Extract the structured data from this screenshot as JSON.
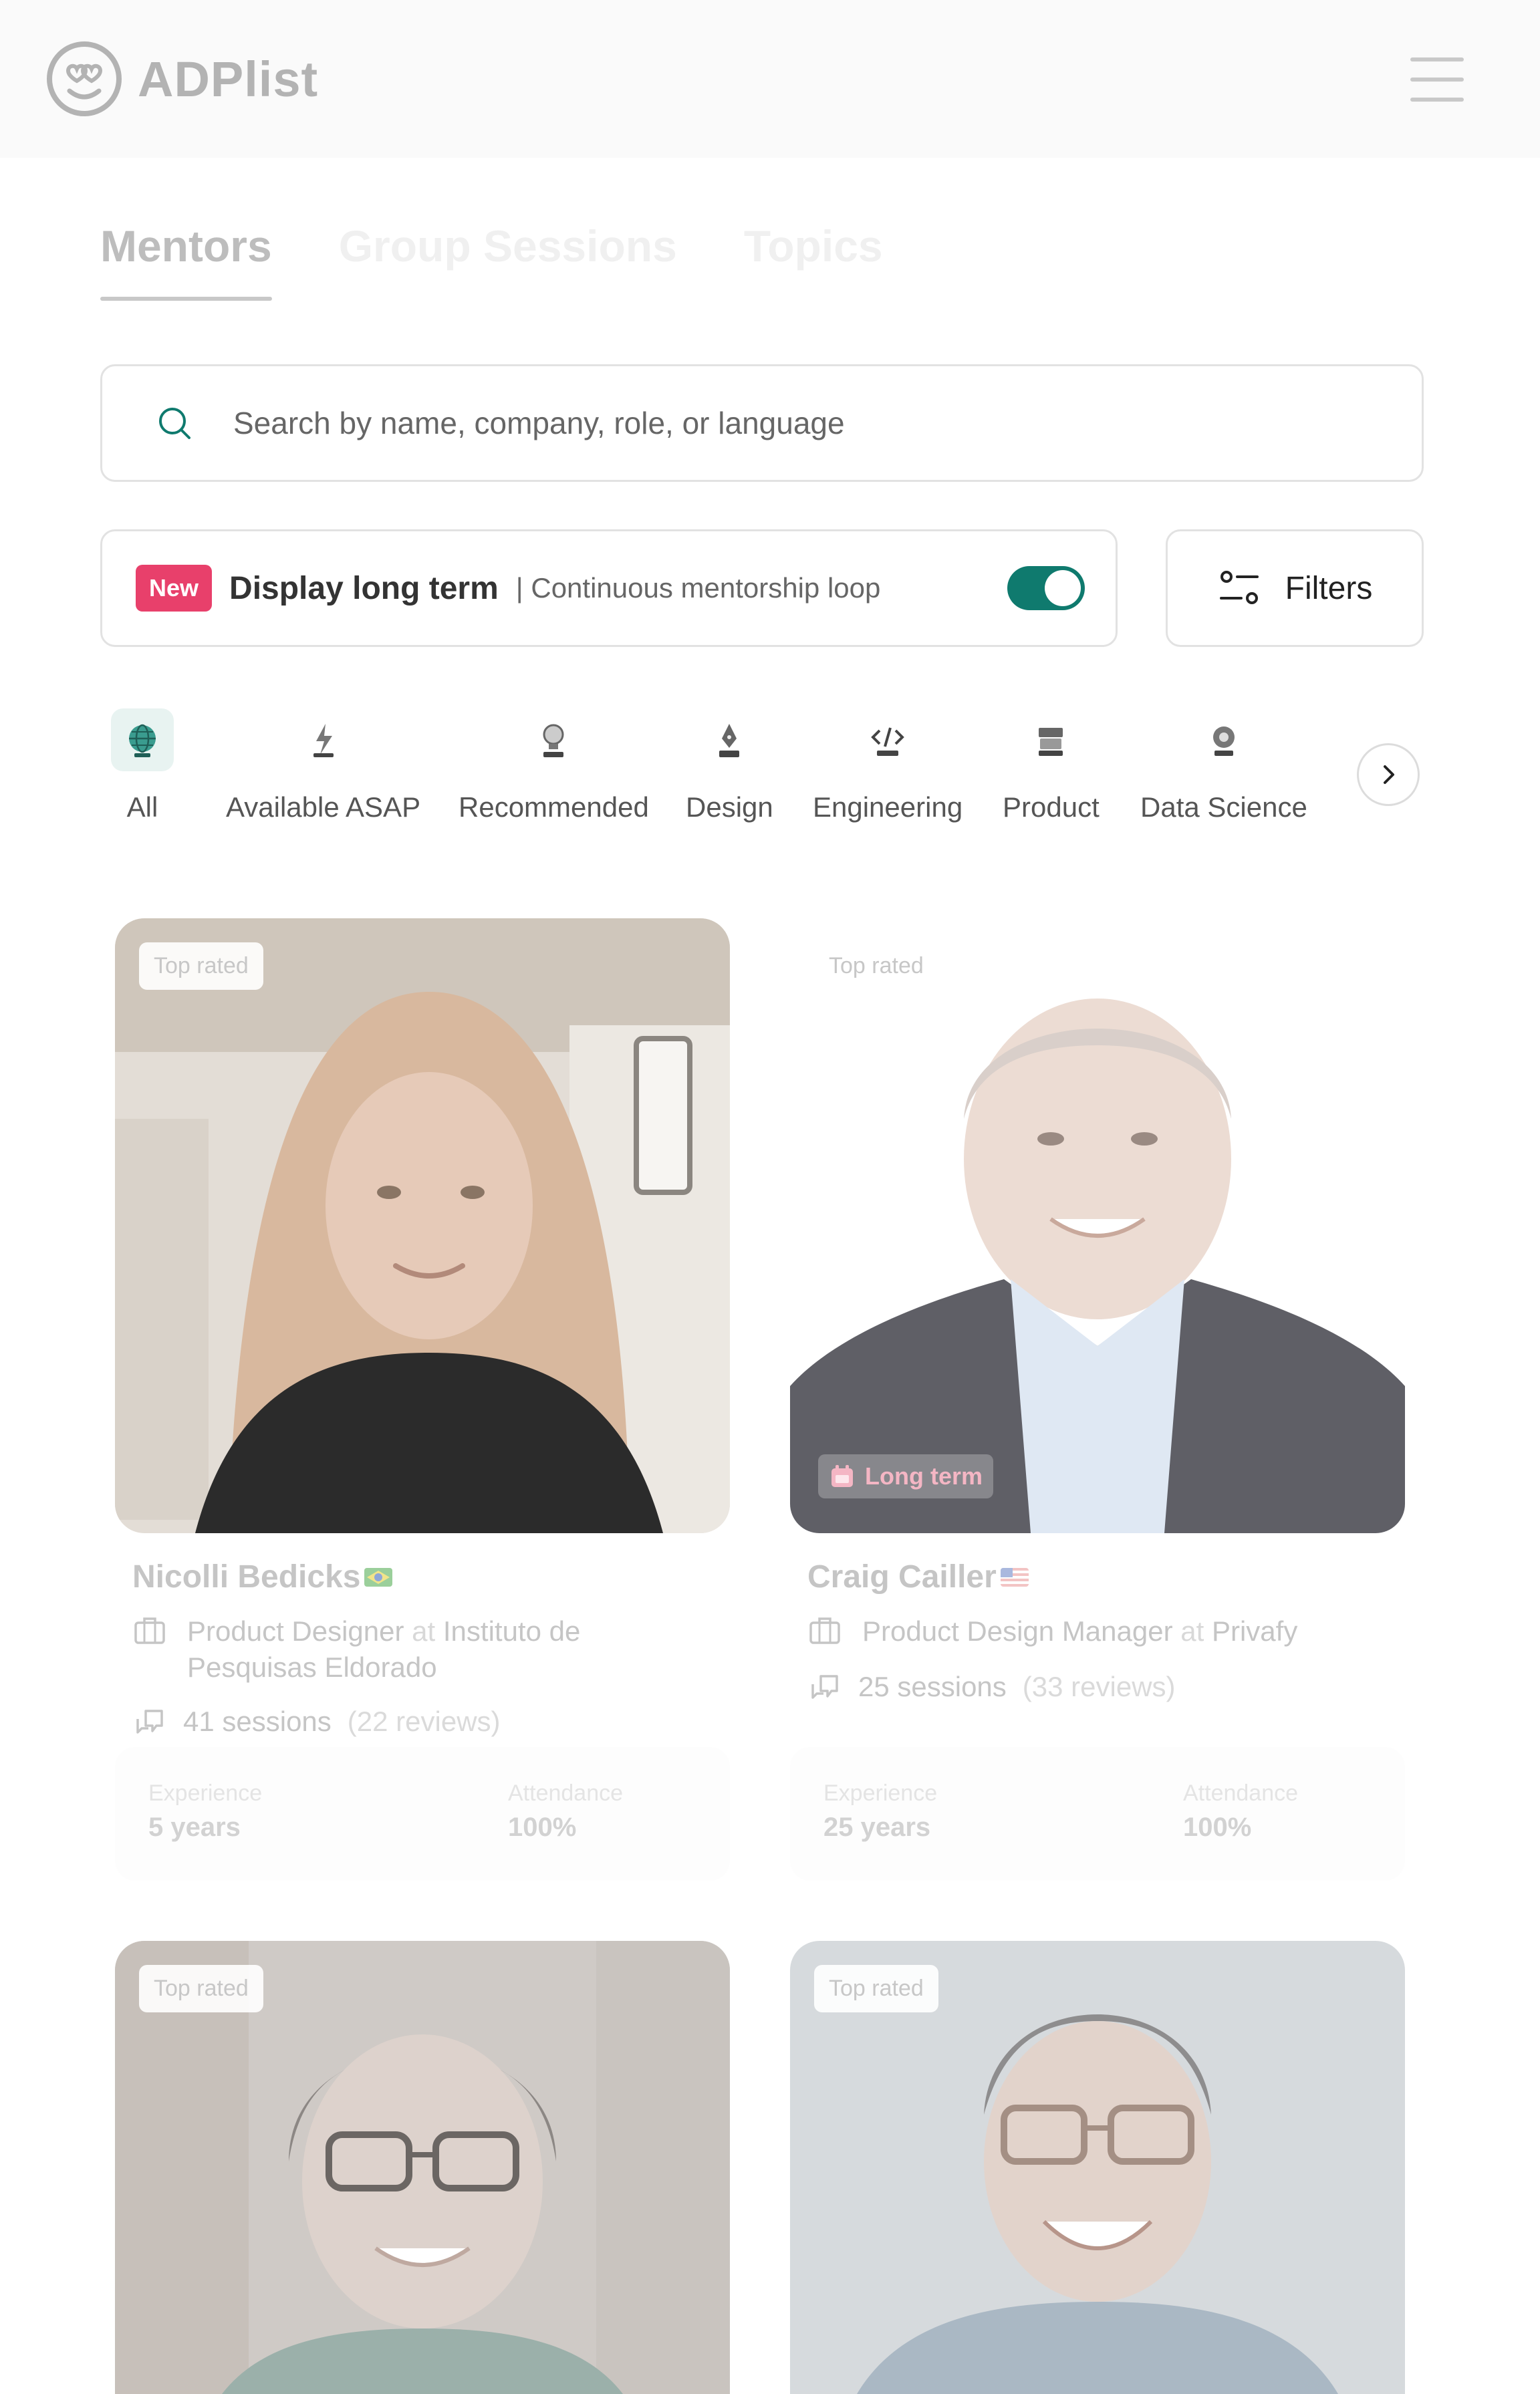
{
  "app": {
    "name": "ADPlist"
  },
  "tabs": [
    {
      "label": "Mentors",
      "active": true
    },
    {
      "label": "Group Sessions",
      "active": false
    },
    {
      "label": "Topics",
      "active": false
    }
  ],
  "search": {
    "placeholder": "Search by name, company, role, or language"
  },
  "long_term": {
    "badge": "New",
    "title": "Display long term",
    "subtitle": "| Continuous mentorship loop",
    "toggle_on": true
  },
  "filters": {
    "label": "Filters"
  },
  "categories": [
    {
      "label": "All",
      "icon": "globe-icon",
      "active": true
    },
    {
      "label": "Available ASAP",
      "icon": "lightning-icon",
      "active": false
    },
    {
      "label": "Recommended",
      "icon": "bulb-icon",
      "active": false
    },
    {
      "label": "Design",
      "icon": "pen-nib-icon",
      "active": false
    },
    {
      "label": "Engineering",
      "icon": "code-icon",
      "active": false
    },
    {
      "label": "Product",
      "icon": "box-icon",
      "active": false
    },
    {
      "label": "Data Science",
      "icon": "data-gear-icon",
      "active": false
    }
  ],
  "mentors": [
    {
      "name": "Nicolli Bedicks",
      "flag": "BR",
      "top_rated": "Top rated",
      "role": "Product Designer",
      "at": "at",
      "company": "Instituto de Pesquisas Eldorado",
      "sessions": "41 sessions",
      "reviews": "(22 reviews)",
      "experience_label": "Experience",
      "experience": "5 years",
      "attendance_label": "Attendance",
      "attendance": "100%"
    },
    {
      "name": "Craig Cailler",
      "flag": "US",
      "top_rated": "Top rated",
      "long_term": "Long term",
      "role": "Product Design Manager",
      "at": "at",
      "company": "Privafy",
      "sessions": "25 sessions",
      "reviews": "(33 reviews)",
      "experience_label": "Experience",
      "experience": "25 years",
      "attendance_label": "Attendance",
      "attendance": "100%"
    },
    {
      "top_rated": "Top rated"
    },
    {
      "top_rated": "Top rated"
    }
  ],
  "colors": {
    "accent": "#0f7a6e",
    "new_badge": "#e8406b",
    "long_term": "#f4b6c4"
  }
}
